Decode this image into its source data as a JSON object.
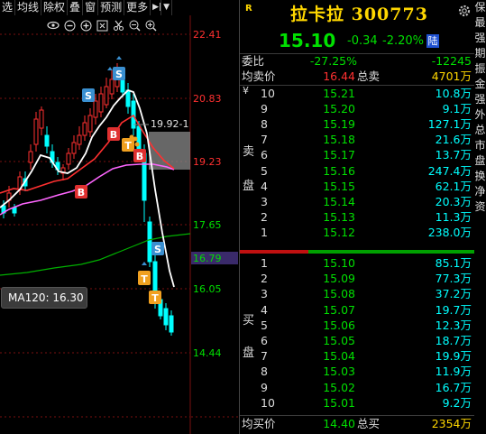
{
  "toolbar": {
    "buttons": [
      "选",
      "均线",
      "除权",
      "叠",
      "窗",
      "预测",
      "更多"
    ],
    "play_icon": "play-icon",
    "dropdown_icon": "dropdown-icon"
  },
  "icon_bar": [
    "eye-icon",
    "minus-icon",
    "plus-icon",
    "expand-icon",
    "scissors-icon",
    "zoom-out-icon",
    "zoom-in-icon"
  ],
  "chart": {
    "price_levels": [
      "22.41",
      "20.83",
      "19.23",
      "17.65",
      "16.05",
      "14.44"
    ],
    "current_price_tag": "16.79",
    "annotation": "19.92-1",
    "ma_tooltip": "MA120: 16.30",
    "colors": {
      "up": "#ff3030",
      "down": "#00ffff",
      "ma5": "#ffffff",
      "ma10": "#ff3030",
      "ma20": "#ff66ff",
      "ma120": "#00b000",
      "price_tag_bg": "#3a2a6a"
    },
    "markers": [
      "S",
      "S",
      "B",
      "T",
      "T",
      "B",
      "B",
      "S",
      "T",
      "T"
    ]
  },
  "header": {
    "badge": "R",
    "name_code": "拉卡拉 300773",
    "price": "15.10",
    "change": "-0.34",
    "pct": "-2.20%",
    "market_badge": "陆"
  },
  "stats": {
    "wb_label": "委比",
    "wb_pct": "-27.25%",
    "wb_diff": "-12245",
    "avg_sell_label": "均卖价",
    "avg_sell": "16.44",
    "total_sell_label": "总卖",
    "total_sell": "4701万",
    "avg_buy_label": "均买价",
    "avg_buy": "14.40",
    "total_buy_label": "总买",
    "total_buy": "2354万"
  },
  "sell_side": {
    "currency": "¥",
    "title_chars": [
      "卖",
      "盘"
    ],
    "levels": [
      {
        "lvl": "10",
        "price": "15.21",
        "vol": "10.8万"
      },
      {
        "lvl": "9",
        "price": "15.20",
        "vol": "9.1万"
      },
      {
        "lvl": "8",
        "price": "15.19",
        "vol": "127.1万"
      },
      {
        "lvl": "7",
        "price": "15.18",
        "vol": "21.6万"
      },
      {
        "lvl": "6",
        "price": "15.17",
        "vol": "13.7万"
      },
      {
        "lvl": "5",
        "price": "15.16",
        "vol": "247.4万"
      },
      {
        "lvl": "4",
        "price": "15.15",
        "vol": "62.1万"
      },
      {
        "lvl": "3",
        "price": "15.14",
        "vol": "20.3万"
      },
      {
        "lvl": "2",
        "price": "15.13",
        "vol": "11.3万"
      },
      {
        "lvl": "1",
        "price": "15.12",
        "vol": "238.0万"
      }
    ]
  },
  "buy_side": {
    "title_chars": [
      "买",
      "盘"
    ],
    "levels": [
      {
        "lvl": "1",
        "price": "15.10",
        "vol": "85.1万"
      },
      {
        "lvl": "2",
        "price": "15.09",
        "vol": "77.3万"
      },
      {
        "lvl": "3",
        "price": "15.08",
        "vol": "37.2万"
      },
      {
        "lvl": "4",
        "price": "15.07",
        "vol": "19.7万"
      },
      {
        "lvl": "5",
        "price": "15.06",
        "vol": "12.3万"
      },
      {
        "lvl": "6",
        "price": "15.05",
        "vol": "18.7万"
      },
      {
        "lvl": "7",
        "price": "15.04",
        "vol": "19.9万"
      },
      {
        "lvl": "8",
        "price": "15.03",
        "vol": "11.9万"
      },
      {
        "lvl": "9",
        "price": "15.02",
        "vol": "16.7万"
      },
      {
        "lvl": "10",
        "price": "15.01",
        "vol": "9.2万"
      }
    ]
  },
  "edge_text": [
    "保",
    "最",
    "强",
    "期",
    "振",
    "金",
    "强",
    "外",
    "总",
    "市",
    "盘",
    "换",
    "净",
    "资"
  ]
}
